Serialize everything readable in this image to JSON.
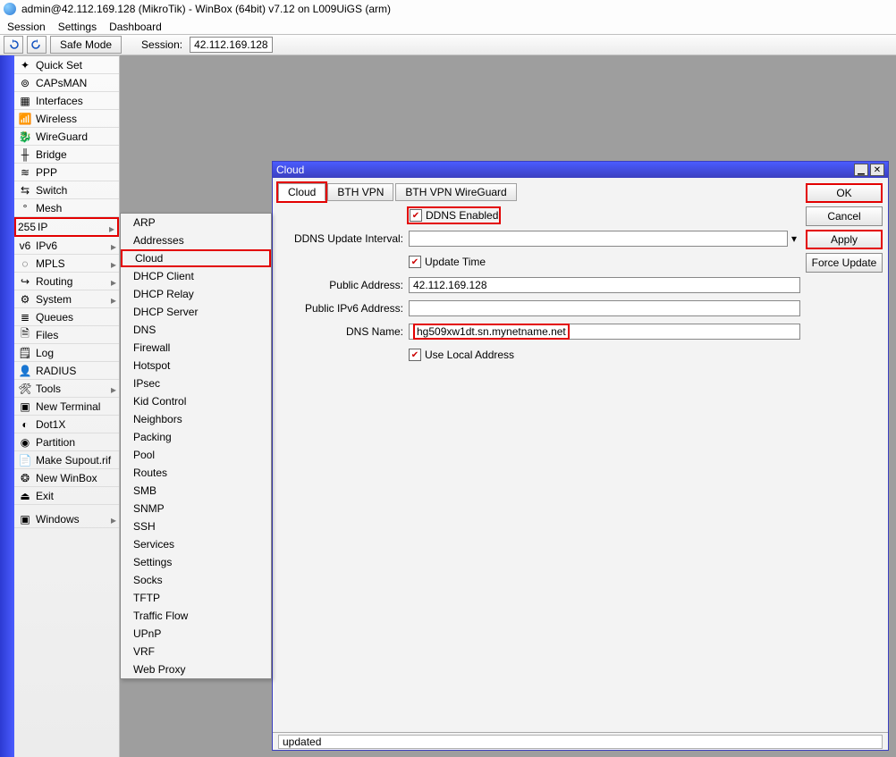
{
  "title": "admin@42.112.169.128 (MikroTik) - WinBox (64bit) v7.12 on L009UiGS (arm)",
  "menubar": {
    "session": "Session",
    "settings": "Settings",
    "dashboard": "Dashboard"
  },
  "toolbar": {
    "safe": "Safe Mode",
    "session_lbl": "Session:",
    "session_val": "42.112.169.128"
  },
  "nav": {
    "items": [
      "Quick Set",
      "CAPsMAN",
      "Interfaces",
      "Wireless",
      "WireGuard",
      "Bridge",
      "PPP",
      "Switch",
      "Mesh",
      "IP",
      "IPv6",
      "MPLS",
      "Routing",
      "System",
      "Queues",
      "Files",
      "Log",
      "RADIUS",
      "Tools",
      "New Terminal",
      "Dot1X",
      "Partition",
      "Make Supout.rif",
      "New WinBox",
      "Exit",
      "Windows"
    ]
  },
  "submenu": {
    "items": [
      "ARP",
      "Addresses",
      "Cloud",
      "DHCP Client",
      "DHCP Relay",
      "DHCP Server",
      "DNS",
      "Firewall",
      "Hotspot",
      "IPsec",
      "Kid Control",
      "Neighbors",
      "Packing",
      "Pool",
      "Routes",
      "SMB",
      "SNMP",
      "SSH",
      "Services",
      "Settings",
      "Socks",
      "TFTP",
      "Traffic Flow",
      "UPnP",
      "VRF",
      "Web Proxy"
    ]
  },
  "dialog": {
    "title": "Cloud",
    "tabs": {
      "t0": "Cloud",
      "t1": "BTH VPN",
      "t2": "BTH VPN WireGuard"
    },
    "labels": {
      "ddns_enabled": "DDNS Enabled",
      "update_interval": "DDNS Update Interval:",
      "update_time": "Update Time",
      "public_addr": "Public Address:",
      "public_v6": "Public IPv6 Address:",
      "dns_name": "DNS Name:",
      "use_local": "Use Local Address"
    },
    "values": {
      "update_interval": "",
      "public_addr": "42.112.169.128",
      "public_v6": "",
      "dns_name": "hg509xw1dt.sn.mynetname.net"
    },
    "buttons": {
      "ok": "OK",
      "cancel": "Cancel",
      "apply": "Apply",
      "force": "Force Update"
    },
    "status": "updated"
  }
}
